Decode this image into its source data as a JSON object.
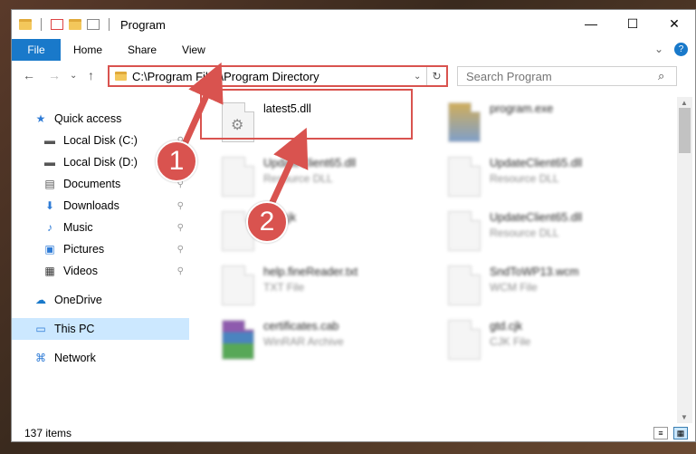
{
  "window": {
    "title": "Program",
    "controls": {
      "minimize": "—",
      "maximize": "☐",
      "close": "✕"
    }
  },
  "ribbon": {
    "tabs": [
      "File",
      "Home",
      "Share",
      "View"
    ],
    "expand_icon": "⌄",
    "help_icon": "?"
  },
  "address": {
    "path": "C:\\Program Files\\Program Directory",
    "dropdown_glyph": "⌄",
    "refresh_glyph": "↻"
  },
  "search": {
    "placeholder": "Search Program",
    "icon": "⌕"
  },
  "nav": {
    "back": "←",
    "forward": "→",
    "recent": "⌄",
    "up": "↑",
    "items": [
      {
        "label": "Quick access",
        "icon": "star-icon",
        "glyph": "★",
        "color": "#2e7bd6"
      },
      {
        "label": "Local Disk (C:)",
        "icon": "drive-icon",
        "glyph": "▬",
        "color": "#555555",
        "pinned": true
      },
      {
        "label": "Local Disk (D:)",
        "icon": "drive-icon",
        "glyph": "▬",
        "color": "#555555",
        "pinned": true
      },
      {
        "label": "Documents",
        "icon": "documents-icon",
        "glyph": "▤",
        "color": "#555555",
        "pinned": true
      },
      {
        "label": "Downloads",
        "icon": "downloads-icon",
        "glyph": "⬇",
        "color": "#2e7bd6",
        "pinned": true
      },
      {
        "label": "Music",
        "icon": "music-icon",
        "glyph": "♪",
        "color": "#2e7bd6",
        "pinned": true
      },
      {
        "label": "Pictures",
        "icon": "pictures-icon",
        "glyph": "▣",
        "color": "#2e7bd6",
        "pinned": true
      },
      {
        "label": "Videos",
        "icon": "videos-icon",
        "glyph": "▦",
        "color": "#333333",
        "pinned": true
      },
      {
        "label": "OneDrive",
        "icon": "onedrive-icon",
        "glyph": "☁",
        "color": "#1979ca"
      },
      {
        "label": "This PC",
        "icon": "this-pc-icon",
        "glyph": "▭",
        "color": "#2e7bd6",
        "selected": true
      },
      {
        "label": "Network",
        "icon": "network-icon",
        "glyph": "⌘",
        "color": "#2e7bd6"
      }
    ],
    "pin_glyph": "📌"
  },
  "files": [
    {
      "name": "latest5.dll",
      "type": "",
      "clear": true
    },
    {
      "name": "program.exe",
      "type": "",
      "kind": "exe"
    },
    {
      "name": "UpdateClient65.dll",
      "type": "Resource DLL"
    },
    {
      "name": "UpdateClient65.dll",
      "type": "Resource DLL"
    },
    {
      "name": "UpdateClient65.dll",
      "type": "Resource DLL"
    },
    {
      "name": "...n.cjk",
      "type": "...e"
    },
    {
      "name": "help.fineReader.txt",
      "type": "TXT File"
    },
    {
      "name": "SndToWP13.wcm",
      "type": "WCM File"
    },
    {
      "name": "certificates.cab",
      "type": "WinRAR Archive",
      "kind": "cab"
    },
    {
      "name": "gtd.cjk",
      "type": "CJK File"
    }
  ],
  "status": {
    "count": "137 items"
  },
  "callouts": [
    "1",
    "2"
  ],
  "colors": {
    "accent": "#1979ca",
    "annotation": "#d9534f",
    "selected": "#cce8ff"
  }
}
